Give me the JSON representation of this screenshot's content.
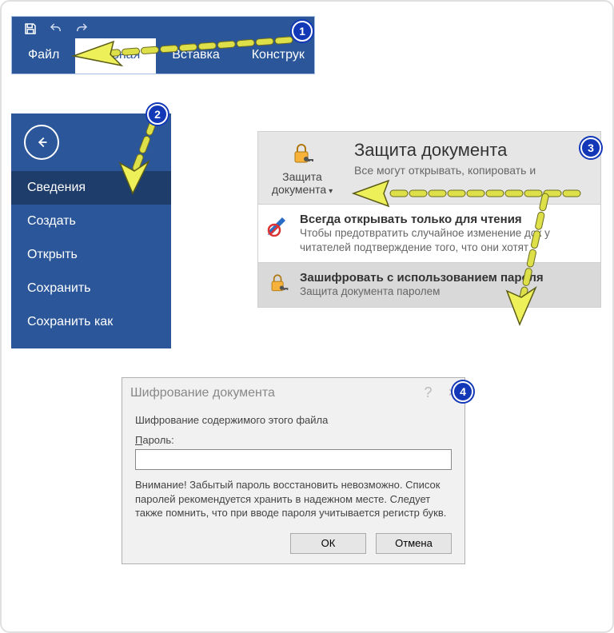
{
  "ribbon": {
    "tabs": [
      "Файл",
      "Главная",
      "Вставка",
      "Конструк"
    ]
  },
  "backstage": {
    "items": [
      "Сведения",
      "Создать",
      "Открыть",
      "Сохранить",
      "Сохранить как"
    ]
  },
  "protect": {
    "button_line1": "Защита",
    "button_line2": "документа",
    "title": "Защита документа",
    "subtitle": "Все могут открывать, копировать и",
    "options": [
      {
        "title": "Всегда открывать только для чтения",
        "desc": "Чтобы предотвратить случайное изменение док у читателей подтверждение того, что они хотят"
      },
      {
        "title": "Зашифровать с использованием пароля",
        "desc": "Защита документа паролем"
      }
    ]
  },
  "dialog": {
    "title": "Шифрование документа",
    "heading": "Шифрование содержимого этого файла",
    "pw_label_u": "П",
    "pw_label_rest": "ароль:",
    "warning": "Внимание! Забытый пароль восстановить невозможно. Список паролей рекомендуется хранить в надежном месте.\nСледует также помнить, что при вводе пароля учитывается регистр букв.",
    "ok": "ОК",
    "cancel": "Отмена"
  },
  "badges": {
    "b1": "1",
    "b2": "2",
    "b3": "3",
    "b4": "4"
  }
}
